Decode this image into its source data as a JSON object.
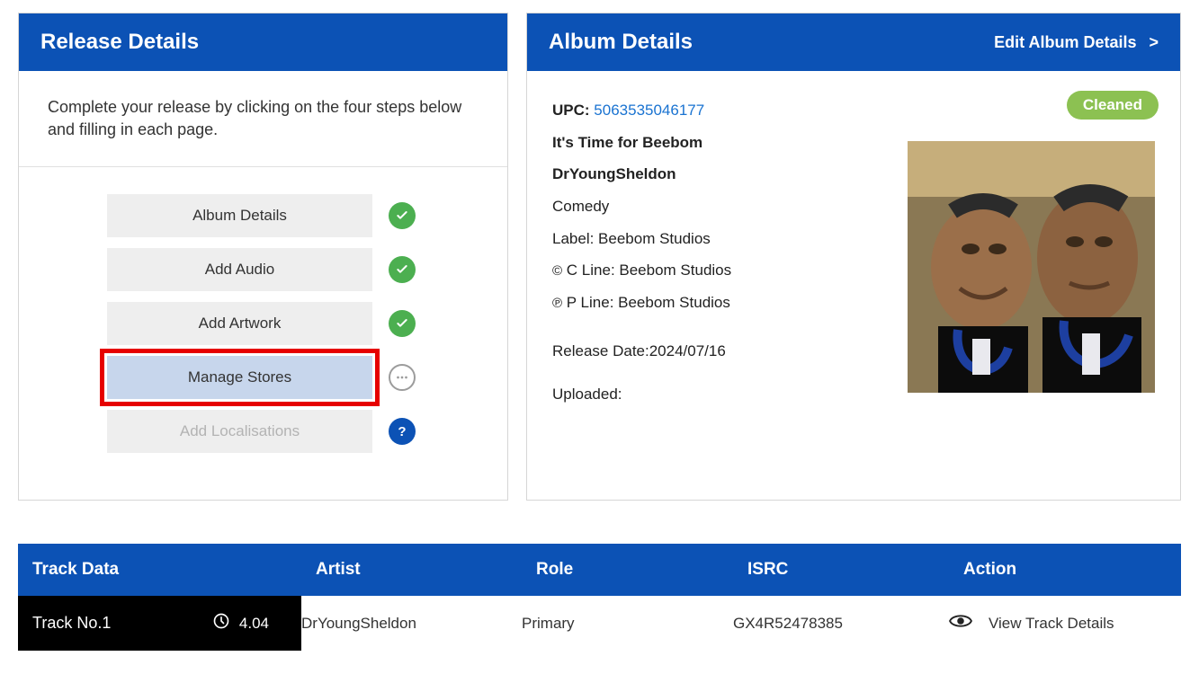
{
  "release": {
    "title": "Release Details",
    "description": "Complete your release by clicking on the four steps below and filling in each page.",
    "steps": [
      {
        "label": "Album Details",
        "status": "check"
      },
      {
        "label": "Add Audio",
        "status": "check"
      },
      {
        "label": "Add Artwork",
        "status": "check"
      },
      {
        "label": "Manage Stores",
        "status": "pending",
        "highlighted": true
      },
      {
        "label": "Add Localisations",
        "status": "help",
        "disabled": true
      }
    ]
  },
  "album": {
    "title": "Album Details",
    "edit_label": "Edit Album Details",
    "badge": "Cleaned",
    "upc_label": "UPC:",
    "upc_value": "5063535046177",
    "album_title": "It's Time for Beebom",
    "artist": "DrYoungSheldon",
    "genre": "Comedy",
    "label_line": "Label: Beebom Studios",
    "c_line": "C Line: Beebom Studios",
    "p_line": "P Line: Beebom Studios",
    "release_date_line": "Release Date:2024/07/16",
    "uploaded_line": "Uploaded:"
  },
  "track_table": {
    "headers": {
      "track": "Track Data",
      "artist": "Artist",
      "role": "Role",
      "isrc": "ISRC",
      "action": "Action"
    },
    "rows": [
      {
        "track_num": "Track No.1",
        "duration": "4.04",
        "artist": "DrYoungSheldon",
        "role": "Primary",
        "isrc": "GX4R52478385",
        "action_label": "View Track Details"
      }
    ]
  }
}
